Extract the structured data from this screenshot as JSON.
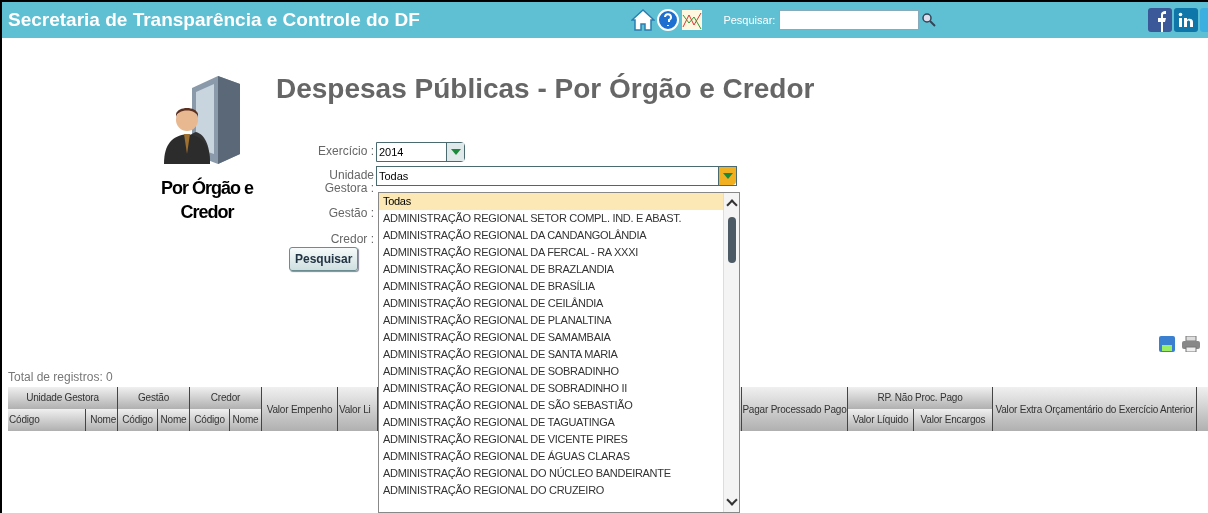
{
  "header": {
    "title": "Secretaria de Transparência e Controle do DF",
    "search_label": "Pesquisar:"
  },
  "page": {
    "title": "Despesas Públicas - Por Órgão e Credor",
    "caption": "Por Órgão e Credor"
  },
  "form": {
    "fields": [
      {
        "label": "Exercício :",
        "kind": "select",
        "value": "2014",
        "open": false
      },
      {
        "label": "Unidade Gestora :",
        "kind": "select",
        "value": "Todas",
        "open": true
      },
      {
        "label": "Gestão :",
        "kind": "hidden"
      },
      {
        "label": "Credor :",
        "kind": "hidden"
      }
    ],
    "button": "Pesquisar"
  },
  "dropdown": {
    "options": [
      {
        "label": "Todas",
        "selected": true
      },
      {
        "label": "ADMINISTRAÇÃO REGIONAL SETOR COMPL. IND. E ABAST.",
        "selected": false
      },
      {
        "label": "ADMINISTRAÇÃO REGIONAL DA CANDANGOLÂNDIA",
        "selected": false
      },
      {
        "label": "ADMINISTRAÇÃO REGIONAL DA FERCAL - RA XXXI",
        "selected": false
      },
      {
        "label": "ADMINISTRAÇÃO REGIONAL DE BRAZLANDIA",
        "selected": false
      },
      {
        "label": "ADMINISTRAÇÃO REGIONAL DE BRASÍLIA",
        "selected": false
      },
      {
        "label": "ADMINISTRAÇÃO REGIONAL DE CEILÂNDIA",
        "selected": false
      },
      {
        "label": "ADMINISTRAÇÃO REGIONAL DE PLANALTINA",
        "selected": false
      },
      {
        "label": "ADMINISTRAÇÃO REGIONAL DE SAMAMBAIA",
        "selected": false
      },
      {
        "label": "ADMINISTRAÇÃO REGIONAL DE SANTA MARIA",
        "selected": false
      },
      {
        "label": "ADMINISTRAÇÃO REGIONAL DE SOBRADINHO",
        "selected": false
      },
      {
        "label": "ADMINISTRAÇÃO REGIONAL DE SOBRADINHO II",
        "selected": false
      },
      {
        "label": "ADMINISTRAÇÃO REGIONAL DE SÃO SEBASTIÃO",
        "selected": false
      },
      {
        "label": "ADMINISTRAÇÃO REGIONAL DE TAGUATINGA",
        "selected": false
      },
      {
        "label": "ADMINISTRAÇÃO REGIONAL DE VICENTE PIRES",
        "selected": false
      },
      {
        "label": "ADMINISTRAÇÃO REGIONAL DE ÁGUAS CLARAS",
        "selected": false
      },
      {
        "label": "ADMINISTRAÇÃO REGIONAL DO NÚCLEO BANDEIRANTE",
        "selected": false
      },
      {
        "label": "ADMINISTRAÇÃO REGIONAL DO CRUZEIRO",
        "selected": false
      }
    ]
  },
  "results": {
    "total": "Total de registros: 0"
  },
  "table": {
    "columns": [
      {
        "label": "Unidade Gestora",
        "children": [
          {
            "label": "Código"
          },
          {
            "label": "Nome"
          }
        ]
      },
      {
        "label": "Gestão",
        "children": [
          {
            "label": "Código"
          },
          {
            "label": "Nome"
          }
        ]
      },
      {
        "label": "Credor",
        "children": [
          {
            "label": "Código"
          },
          {
            "label": "Nome"
          }
        ]
      },
      {
        "label": "Valor Empenho"
      },
      {
        "label": "Valor Li"
      },
      {
        "label": "Pagar Processado Pago"
      },
      {
        "label": "RP. Não Proc. Pago",
        "children": [
          {
            "label": "Valor Líquido"
          },
          {
            "label": "Valor Encargos"
          }
        ]
      },
      {
        "label": "Valor Extra Orçamentário do Exercício Anterior"
      }
    ]
  }
}
